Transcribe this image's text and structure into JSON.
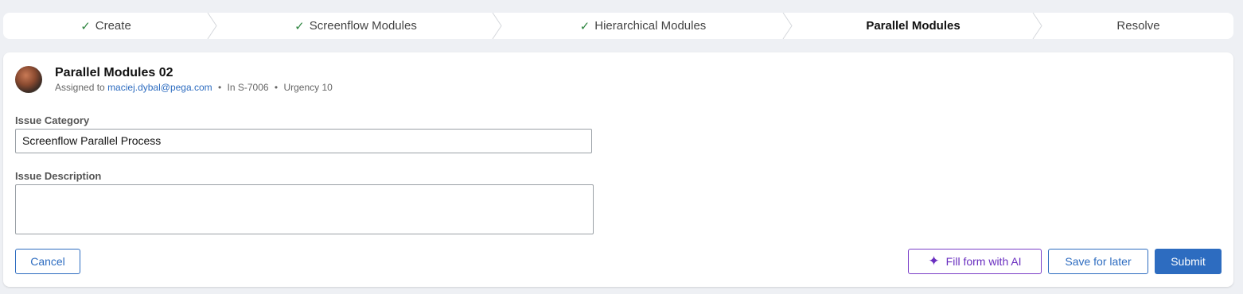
{
  "stepper": {
    "steps": [
      {
        "label": "Create",
        "status": "done"
      },
      {
        "label": "Screenflow Modules",
        "status": "done"
      },
      {
        "label": "Hierarchical Modules",
        "status": "done"
      },
      {
        "label": "Parallel Modules",
        "status": "current"
      },
      {
        "label": "Resolve",
        "status": "pending"
      }
    ],
    "check_icon": "check-icon",
    "separator_icon": "chevron-right-icon"
  },
  "case": {
    "title": "Parallel Modules 02",
    "assigned_prefix": "Assigned to",
    "assignee": "maciej.dybal@pega.com",
    "case_id": "In S-7006",
    "urgency": "Urgency 10"
  },
  "form": {
    "issue_category": {
      "label": "Issue Category",
      "value": "Screenflow Parallel Process"
    },
    "issue_description": {
      "label": "Issue Description",
      "value": ""
    }
  },
  "actions": {
    "cancel": "Cancel",
    "fill_ai": "Fill form with AI",
    "save_later": "Save for later",
    "submit": "Submit"
  },
  "colors": {
    "accent": "#2d6cc0",
    "ai_accent": "#6a2fc0",
    "check": "#2e8540"
  }
}
